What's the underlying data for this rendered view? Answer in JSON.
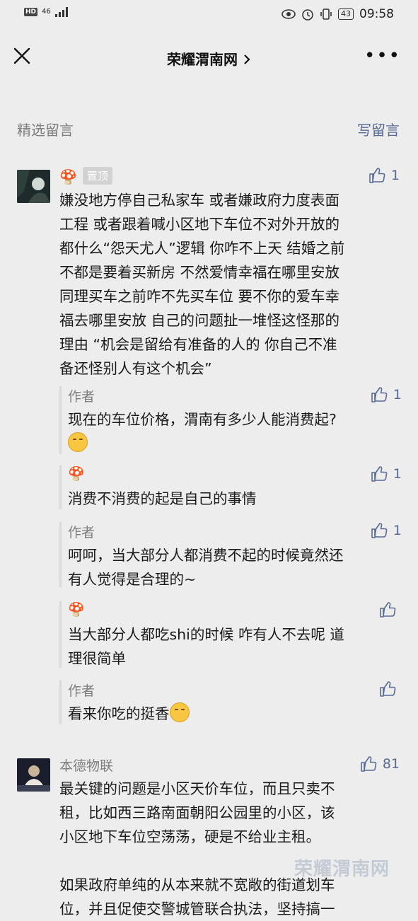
{
  "status_bar": {
    "hd": "HD",
    "network": "46",
    "battery": "43",
    "time": "09:58"
  },
  "nav": {
    "title": "荣耀渭南网",
    "more": "•••"
  },
  "section": {
    "title": "精选留言",
    "write": "写留言"
  },
  "comments": [
    {
      "name": "🍄",
      "pin_label": "置顶",
      "likes": "1",
      "text_lines": [
        "嫌没地方停自己私家车 或者嫌政府力度表面",
        "工程 或者跟着喊小区地下车位不对外开放的",
        "都什么“怨天尤人”逻辑 你咋不上天  结婚之前",
        "不都是要着买新房 不然爱情幸福在哪里安放",
        "同理买车之前咋不先买车位 要不你的爱车幸",
        "福去哪里安放 自己的问题扯一堆怪这怪那的",
        "理由 “机会是留给有准备的人的 你自己不准",
        "备还怪别人有这个机会”"
      ],
      "replies": [
        {
          "name": "作者",
          "likes": "1",
          "lines": [
            "现在的车位价格，渭南有多少人能消费起?"
          ],
          "emoji_line": true
        },
        {
          "name": "🍄",
          "likes": "1",
          "lines": [
            "消费不消费的起是自己的事情"
          ]
        },
        {
          "name": "作者",
          "likes": "1",
          "lines": [
            "呵呵，当大部分人都消费不起的时候竟然还",
            "有人觉得是合理的~"
          ]
        },
        {
          "name": "🍄",
          "likes": "",
          "lines": [
            "当大部分人都吃shi的时候 咋有人不去呢 道",
            "理很简单"
          ]
        },
        {
          "name": "作者",
          "likes": "",
          "lines": [
            "看来你吃的挺香"
          ],
          "emoji_inline": true
        }
      ]
    },
    {
      "name": "本德物联",
      "likes": "81",
      "text_lines": [
        "最关键的问题是小区天价车位，而且只卖不",
        "租，比如西三路南面朝阳公园里的小区，该",
        "小区地下车位空荡荡，硬是不给业主租。",
        "",
        "如果政府单纯的从本来就不宽敞的街道划车",
        "位，并且促使交警城管联合执法，坚持搞一"
      ]
    }
  ],
  "watermark": "荣耀渭南网"
}
